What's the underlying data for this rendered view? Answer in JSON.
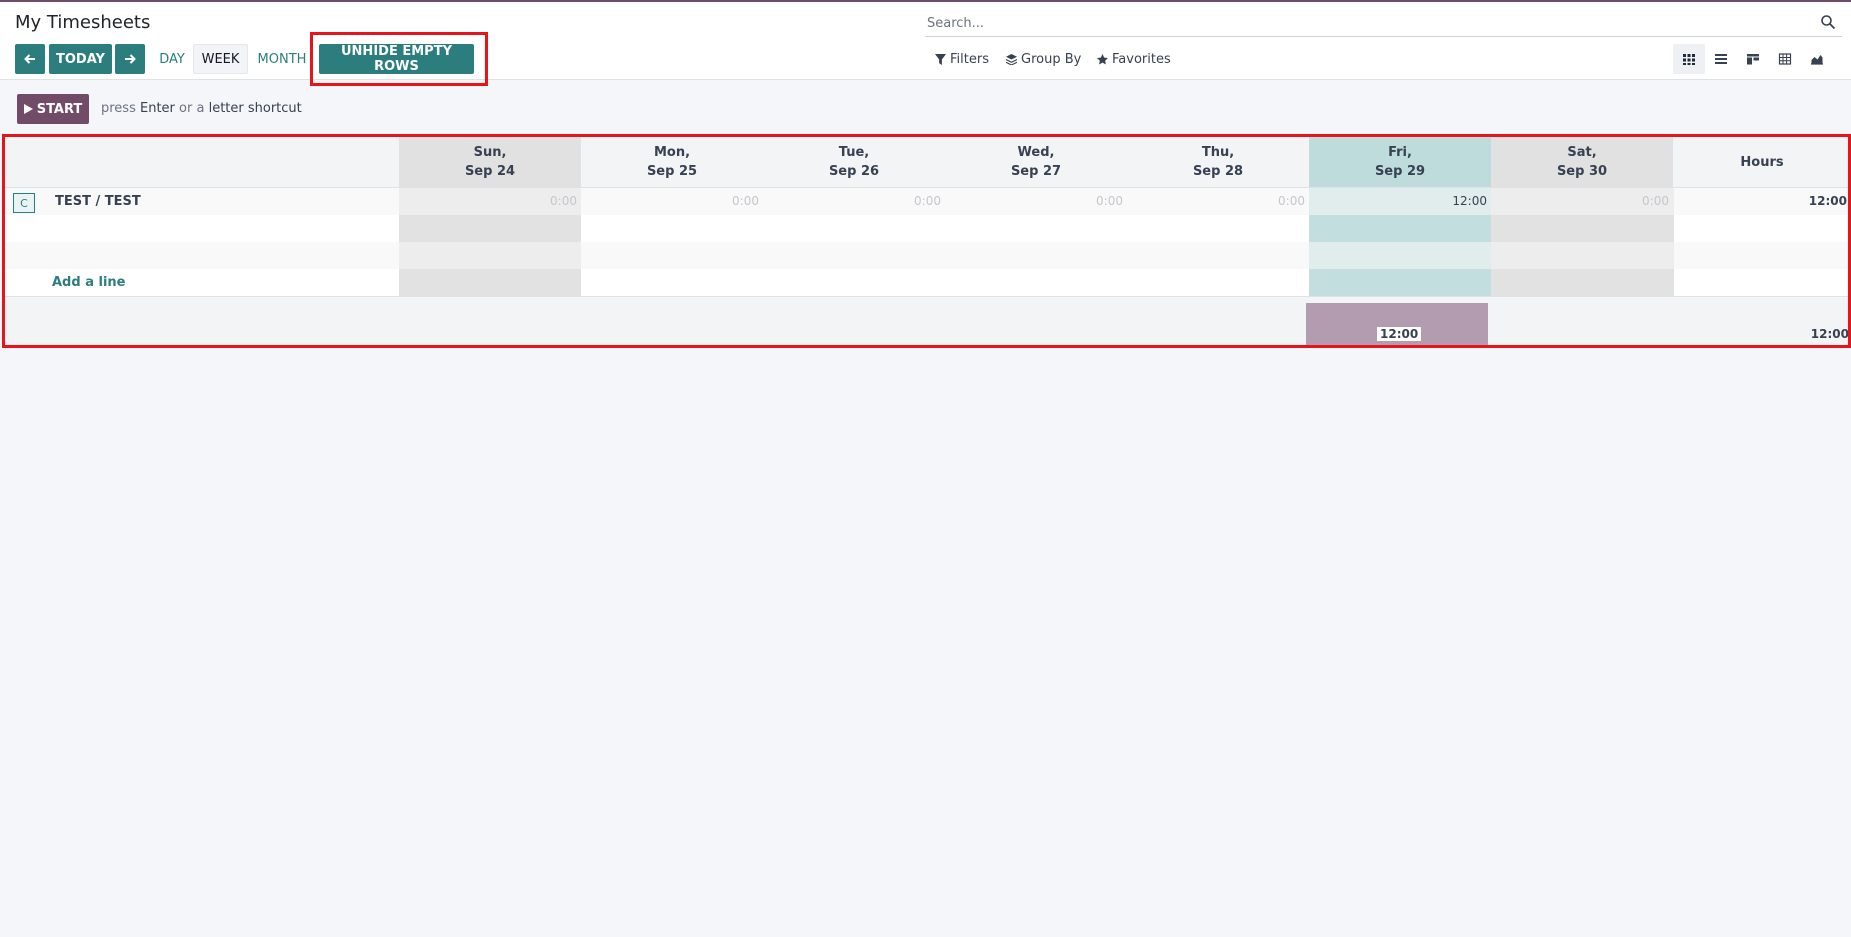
{
  "header": {
    "title": "My Timesheets",
    "today_label": "TODAY",
    "ranges": [
      "DAY",
      "WEEK",
      "MONTH"
    ],
    "active_range": "WEEK",
    "unhide_label": "UNHIDE EMPTY ROWS"
  },
  "search": {
    "placeholder": "Search..."
  },
  "filters": {
    "filters_label": "Filters",
    "groupby_label": "Group By",
    "favorites_label": "Favorites"
  },
  "views": [
    "grid",
    "list",
    "kanban",
    "pivot",
    "graph"
  ],
  "timer": {
    "start_label": "START",
    "hint_prefix": "press",
    "hint_key": "Enter",
    "hint_mid": "or a",
    "hint_suffix": "letter shortcut"
  },
  "grid": {
    "days": [
      {
        "dow": "Sun,",
        "date": "Sep 24",
        "kind": "weekend"
      },
      {
        "dow": "Mon,",
        "date": "Sep 25",
        "kind": "weekday"
      },
      {
        "dow": "Tue,",
        "date": "Sep 26",
        "kind": "weekday"
      },
      {
        "dow": "Wed,",
        "date": "Sep 27",
        "kind": "weekday"
      },
      {
        "dow": "Thu,",
        "date": "Sep 28",
        "kind": "weekday"
      },
      {
        "dow": "Fri,",
        "date": "Sep 29",
        "kind": "today"
      },
      {
        "dow": "Sat,",
        "date": "Sep 30",
        "kind": "weekend"
      }
    ],
    "total_header": "Hours",
    "rows": [
      {
        "avatar": "C",
        "label": "TEST / TEST",
        "values": [
          "0:00",
          "0:00",
          "0:00",
          "0:00",
          "0:00",
          "12:00",
          "0:00"
        ],
        "total": "12:00"
      }
    ],
    "add_line_label": "Add a line",
    "footer": {
      "day_total": "12:00",
      "grand_total": "12:00"
    }
  },
  "colors": {
    "primary": "#2c7e7e",
    "brand": "#714B67",
    "highlight": "#e8141c"
  }
}
